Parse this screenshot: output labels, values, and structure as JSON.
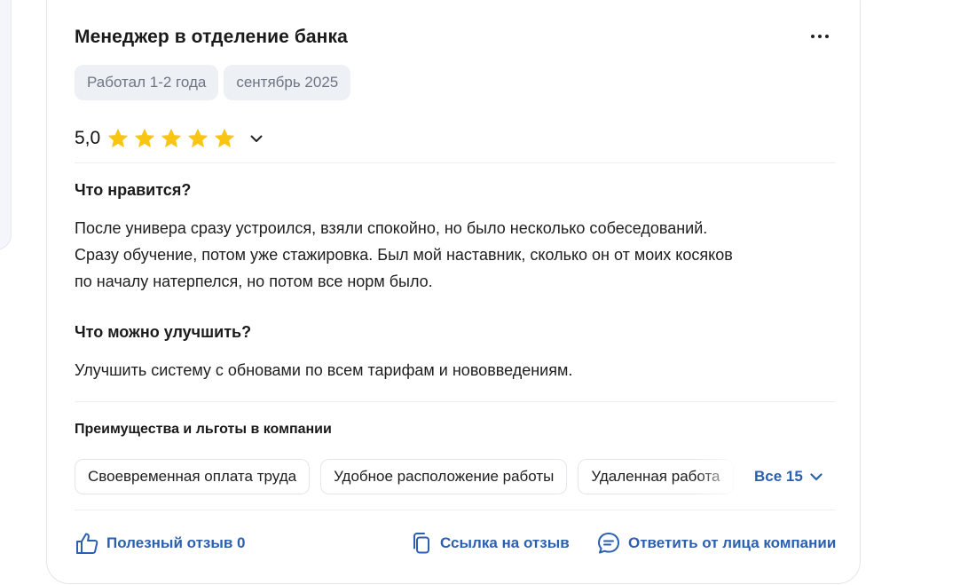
{
  "review": {
    "title": "Менеджер в отделение банка",
    "tags": [
      "Работал 1-2 года",
      "сентябрь 2025"
    ],
    "rating": {
      "value_text": "5,0",
      "stars_filled": 5,
      "stars_total": 5
    },
    "likes": {
      "heading": "Что нравится?",
      "lines": [
        "После универа сразу устроился, взяли спокойно, но было несколько собеседований.",
        "Сразу обучение, потом уже стажировка. Был мой наставник, сколько он от моих косяков",
        "по началу натерпелся, но потом все норм было."
      ]
    },
    "improve": {
      "heading": "Что можно улучшить?",
      "text": "Улучшить систему с обновами по всем тарифам и нововведениям."
    },
    "benefits": {
      "heading": "Преимущества и льготы в компании",
      "chips": [
        "Своевременная оплата труда",
        "Удобное расположение работы",
        "Удаленная работа"
      ],
      "show_all_label": "Все 15"
    },
    "actions": {
      "helpful_label": "Полезный отзыв 0",
      "link_label": "Ссылка на отзыв",
      "reply_label": "Ответить от лица компании"
    }
  },
  "colors": {
    "accent_blue": "#2b5fb0",
    "star_yellow": "#f9c513",
    "tag_bg": "#edf0f5",
    "tag_text": "#6e7683"
  },
  "icons": {
    "menu": "more-horizontal-icon",
    "star": "star-icon",
    "rating_toggle": "chevron-down-icon",
    "helpful": "thumbs-up-icon",
    "link": "copy-icon",
    "reply": "chat-bubble-icon"
  }
}
